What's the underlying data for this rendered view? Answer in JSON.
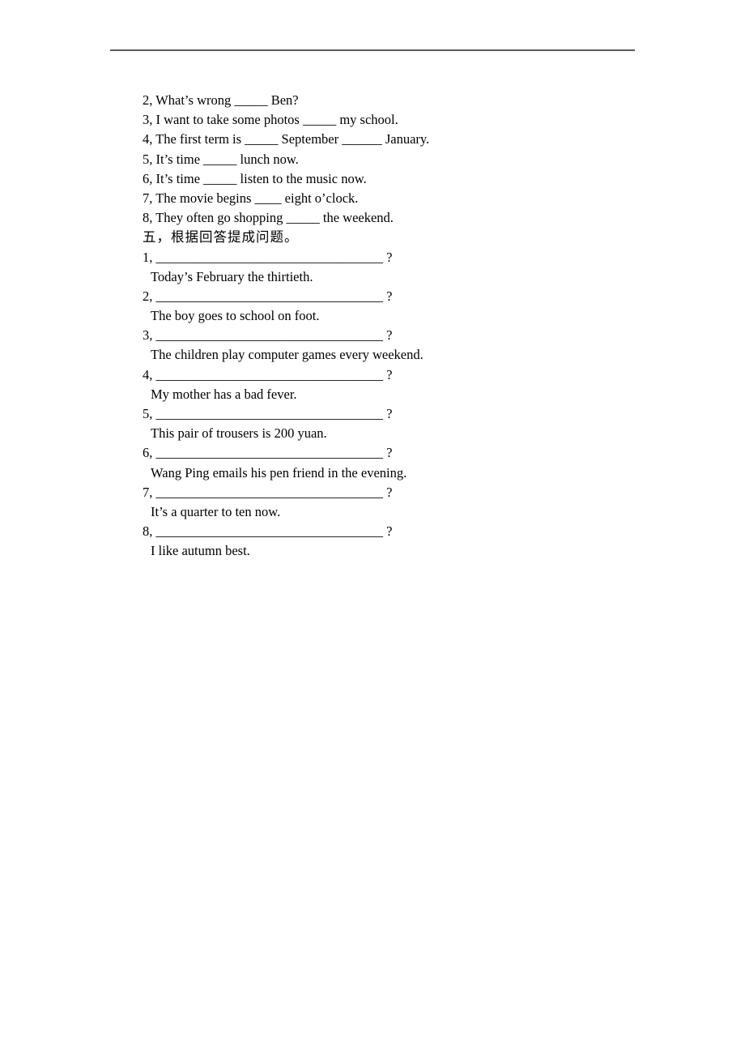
{
  "fill_in_items": [
    "2, What’s wrong _____ Ben?",
    "3, I want to take some photos _____ my school.",
    "4, The first term is _____ September ______ January.",
    "5, It’s time _____ lunch now.",
    "6, It’s time _____ listen to the music now.",
    "7, The movie begins ____ eight o’clock.",
    "8, They often go shopping _____ the weekend."
  ],
  "section_five": {
    "heading": "五，根据回答提成问题。",
    "items": [
      {
        "question": "1, __________________________________ ?",
        "answer": "Today’s February the thirtieth."
      },
      {
        "question": "2, __________________________________ ?",
        "answer": "The boy goes to school on foot."
      },
      {
        "question": "3, __________________________________ ?",
        "answer": "The children play computer games every weekend."
      },
      {
        "question": "4, __________________________________ ?",
        "answer": "My mother has a bad fever."
      },
      {
        "question": "5, __________________________________ ?",
        "answer": "This pair of trousers is 200 yuan."
      },
      {
        "question": "6, __________________________________ ?",
        "answer": "Wang Ping emails his pen friend in the evening."
      },
      {
        "question": "7, __________________________________ ?",
        "answer": "It’s a quarter to ten now."
      },
      {
        "question": "8, __________________________________ ?",
        "answer": "I like autumn best."
      }
    ]
  }
}
